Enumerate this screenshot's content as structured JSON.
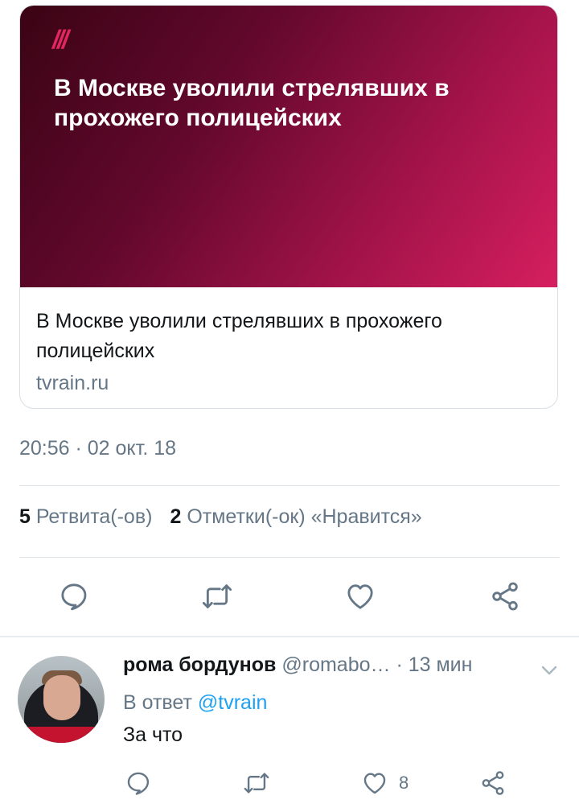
{
  "card": {
    "brand_mark": "///",
    "image_headline": "В Москве уволили стрелявших в прохожего полицейских",
    "title": "В Москве уволили стрелявших в прохожего полицейских",
    "domain": "tvrain.ru"
  },
  "tweet": {
    "timestamp": "20:56 · 02 окт. 18",
    "retweets_count": "5",
    "retweets_label": "Ретвита(-ов)",
    "likes_count": "2",
    "likes_label": "Отметки(-ок) «Нравится»"
  },
  "actions": {
    "reply_icon": "reply-icon",
    "retweet_icon": "retweet-icon",
    "like_icon": "heart-icon",
    "share_icon": "share-icon"
  },
  "reply": {
    "name": "рома бордунов",
    "handle": "@romabo…",
    "time": "· 13 мин",
    "reply_to_prefix": "В ответ",
    "reply_to_mention": "@tvrain",
    "text": "За что",
    "like_count": "8"
  },
  "colors": {
    "accent": "#1da1f2",
    "secondary_text": "#657786",
    "brand": "#e3265f"
  }
}
